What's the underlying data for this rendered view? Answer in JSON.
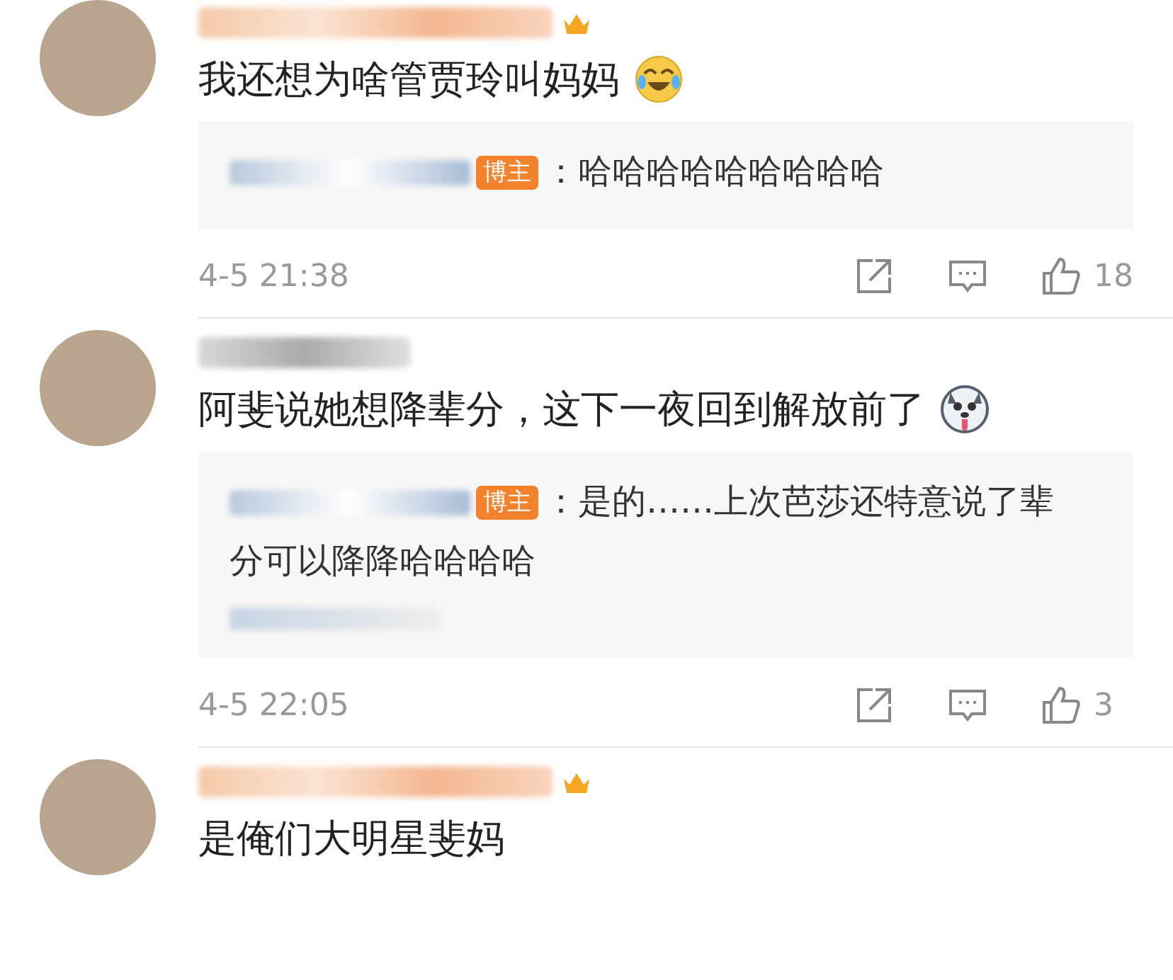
{
  "comments": [
    {
      "vip": true,
      "text": "我还想为啥管贾玲叫妈妈",
      "emoji": {
        "kind": "tears"
      },
      "reply": {
        "badge": "博主",
        "text": "：哈哈哈哈哈哈哈哈哈",
        "more_line": false
      },
      "time": "4-5 21:38",
      "likes": "18"
    },
    {
      "vip": false,
      "text": "阿斐说她想降辈分，这下一夜回到解放前了",
      "emoji": {
        "kind": "dog"
      },
      "reply": {
        "badge": "博主",
        "text": "：是的……上次芭莎还特意说了辈分可以降降哈哈哈哈",
        "more_line": true
      },
      "time": "4-5 22:05",
      "likes": "3"
    },
    {
      "vip": true,
      "text": "是俺们大明星斐妈"
    }
  ]
}
